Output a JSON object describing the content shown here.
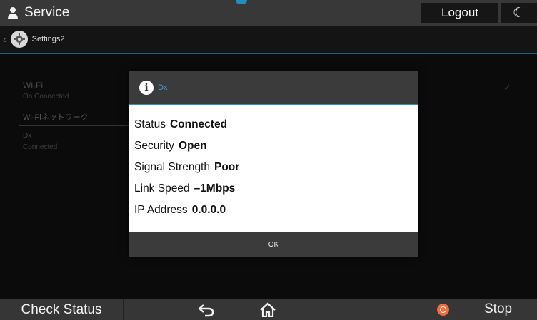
{
  "header": {
    "title": "Service",
    "logout_label": "Logout",
    "moon_glyph": "☾"
  },
  "breadcrumb": {
    "label": "Settings2",
    "back_glyph": "‹"
  },
  "list": {
    "wifi_label": "Wi-Fi",
    "wifi_sub": "On Connected",
    "wifi_check": "✓",
    "network_header": "Wi-Fiネットワーク",
    "network_name": "Dx",
    "network_status": "Connected"
  },
  "dialog": {
    "title": "Dx",
    "info_glyph": "i",
    "fields": [
      {
        "label": "Status",
        "value": "Connected"
      },
      {
        "label": "Security",
        "value": "Open"
      },
      {
        "label": "Signal Strength",
        "value": "Poor"
      },
      {
        "label": "Link Speed",
        "value": "–1Mbps"
      },
      {
        "label": "IP Address",
        "value": "0.0.0.0"
      }
    ],
    "ok_label": "OK"
  },
  "footer": {
    "check_status_label": "Check Status",
    "stop_label": "Stop"
  },
  "colors": {
    "accent": "#2a90c2",
    "stop": "#f06c3c",
    "bar": "#383838"
  },
  "icons": [
    "person-icon",
    "moon-icon",
    "gear-icon",
    "info-icon",
    "back-arrow-icon",
    "home-icon",
    "stop-icon"
  ]
}
